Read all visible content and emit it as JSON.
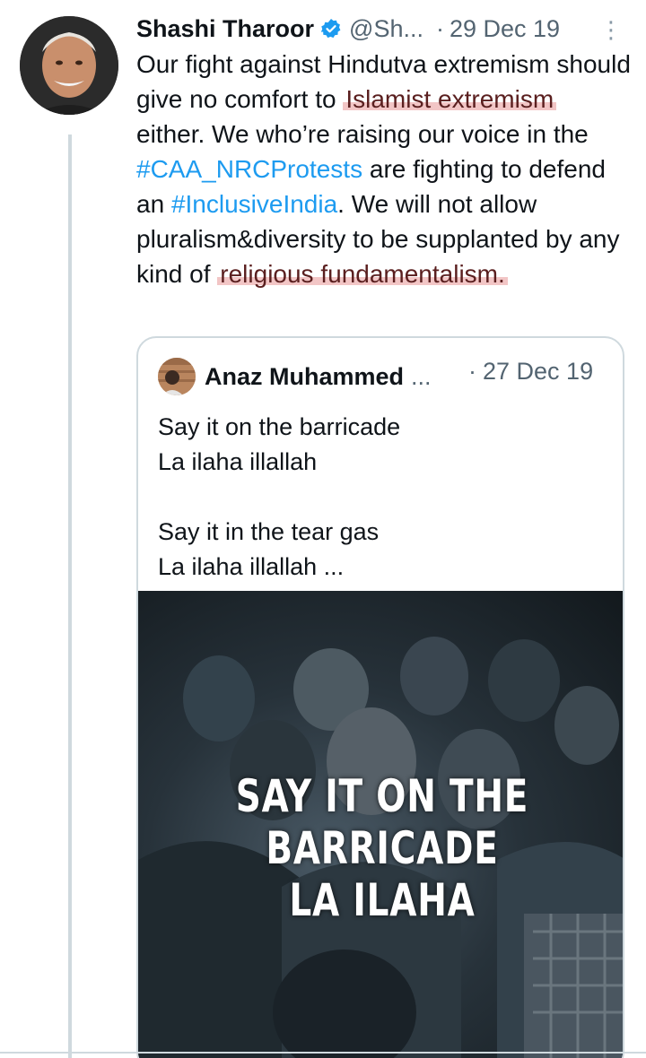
{
  "tweet": {
    "name": "Shashi Tharoor",
    "handle": "@Sh...",
    "dot": "·",
    "date": "29 Dec 19",
    "more": "⋮",
    "body": {
      "t1": "Our fight against Hindutva extremism should give no comfort to ",
      "h1": "Islamist extremism",
      "t2": " either. We who’re raising our voice in the ",
      "tag1": "#CAA_NRCProtests",
      "t3": " are fighting to defend an ",
      "tag2": "#InclusiveIndia",
      "t4": ". We will not allow pluralism&diversity to be supplanted by any kind of ",
      "h2": "religious fundamentalism."
    }
  },
  "quote": {
    "name": "Anaz Muhammed",
    "ellipsis": "...",
    "dot": "·",
    "date": "27 Dec 19",
    "body": "Say it on the barricade\nLa ilaha illallah\n\nSay it in the tear gas\nLa ilaha illallah ...",
    "media_caption": "SAY IT ON THE\nBARRICADE\nLA ILAHA"
  },
  "colors": {
    "link": "#1d9bf0",
    "muted": "#536471",
    "highlight": "#e89696"
  }
}
